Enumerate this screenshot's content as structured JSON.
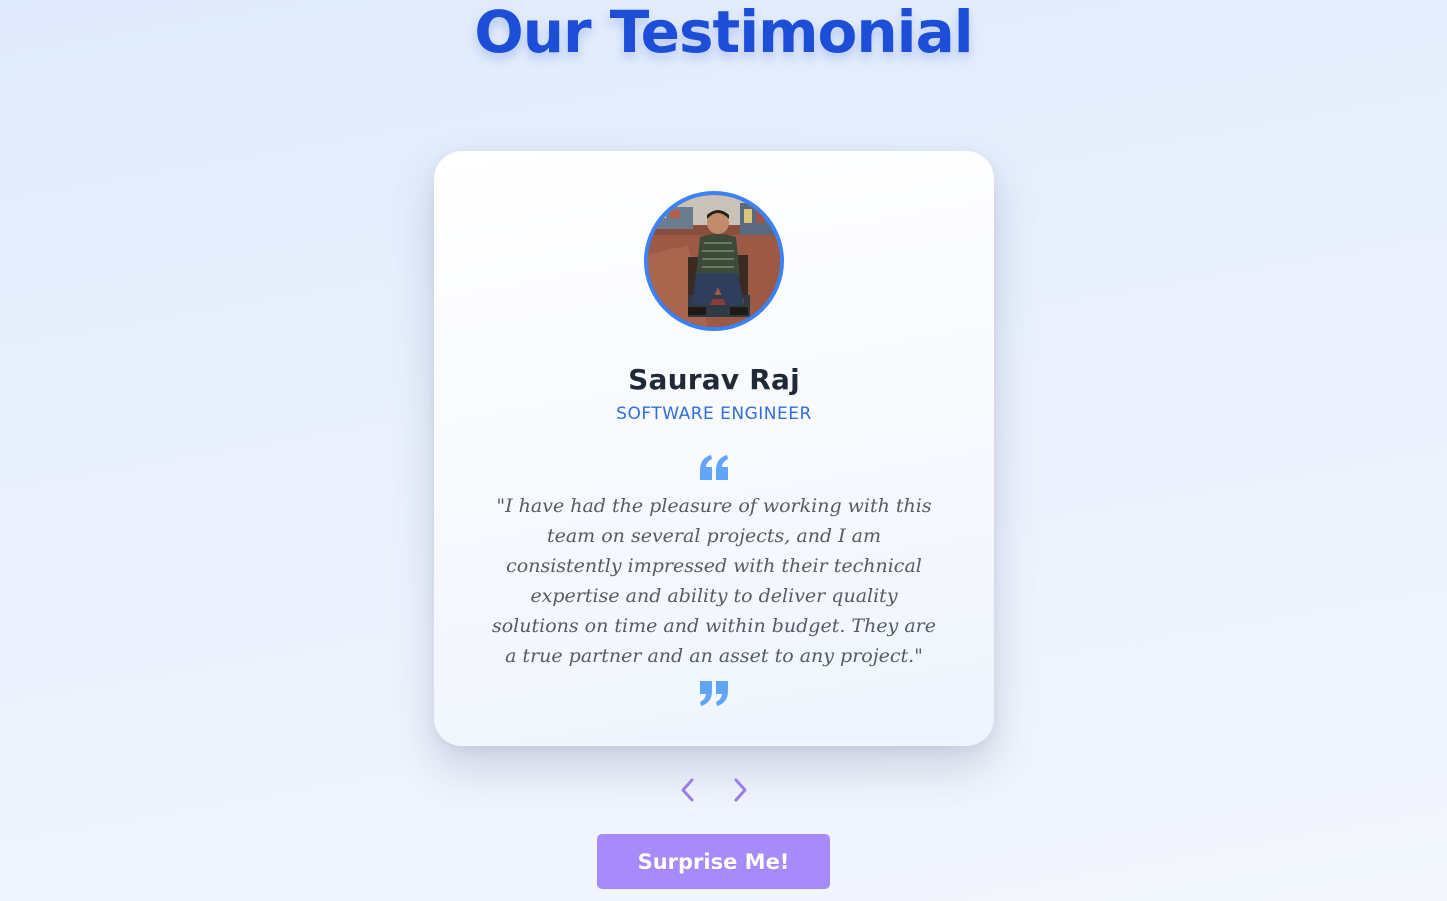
{
  "page": {
    "title": "Our Testimonial"
  },
  "testimonial": {
    "name": "Saurav Raj",
    "role": "SOFTWARE ENGINEER",
    "quote": "\"I have had the pleasure of working with this team on several projects, and I am consistently impressed with their technical expertise and ability to deliver quality solutions on time and within budget. They are a true partner and an asset to any project.\"",
    "avatar_icon": "person-photo"
  },
  "navigation": {
    "prev_icon": "chevron-left-icon",
    "next_icon": "chevron-right-icon"
  },
  "actions": {
    "surprise_label": "Surprise Me!"
  },
  "colors": {
    "title": "#1d4ed8",
    "accent_border": "#3b82f6",
    "role_text": "#2f6fdc",
    "quote_icon": "#60a5fa",
    "nav_arrows": "#9b7fe6",
    "button_bg": "#a78bfa",
    "button_text": "#ffffff"
  }
}
